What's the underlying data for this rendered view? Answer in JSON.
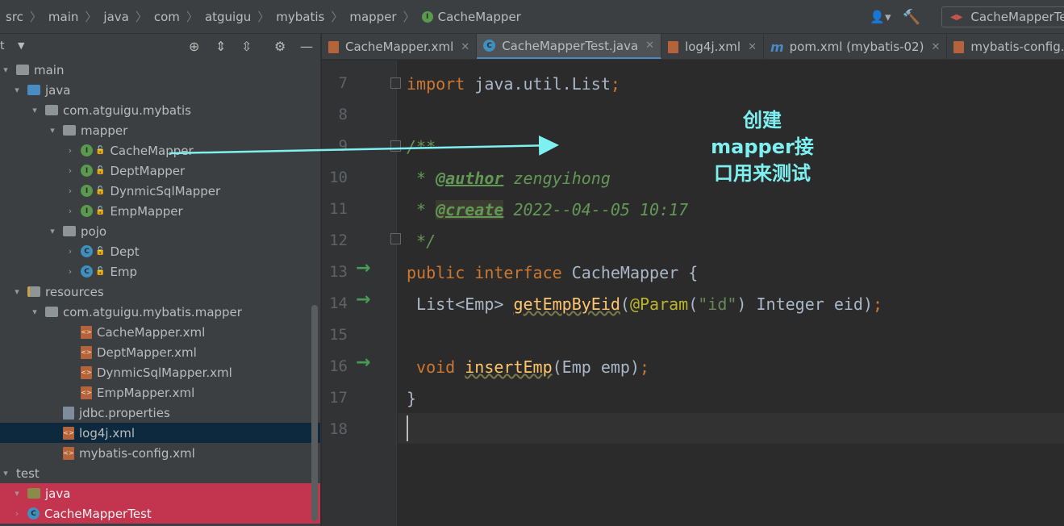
{
  "breadcrumb": [
    "src",
    "main",
    "java",
    "com",
    "atguigu",
    "mybatis",
    "mapper",
    "CacheMapper"
  ],
  "run_config": "CacheMapperTest",
  "project": {
    "title": "t",
    "rows": [
      {
        "label": "main",
        "kind": "folder-grey",
        "indent": 0,
        "arrow": "▾"
      },
      {
        "label": "java",
        "kind": "folder-blue",
        "indent": 1,
        "arrow": "▾"
      },
      {
        "label": "com.atguigu.mybatis",
        "kind": "folder-grey",
        "indent": 2,
        "arrow": "▾"
      },
      {
        "label": "mapper",
        "kind": "folder-grey",
        "indent": 3,
        "arrow": "▾"
      },
      {
        "label": "CacheMapper",
        "kind": "iface",
        "indent": 4,
        "arrow": "›"
      },
      {
        "label": "DeptMapper",
        "kind": "iface",
        "indent": 4,
        "arrow": "›"
      },
      {
        "label": "DynmicSqlMapper",
        "kind": "iface",
        "indent": 4,
        "arrow": "›"
      },
      {
        "label": "EmpMapper",
        "kind": "iface",
        "indent": 4,
        "arrow": "›"
      },
      {
        "label": "pojo",
        "kind": "folder-grey",
        "indent": 3,
        "arrow": "▾"
      },
      {
        "label": "Dept",
        "kind": "class",
        "indent": 4,
        "arrow": "›"
      },
      {
        "label": "Emp",
        "kind": "class",
        "indent": 4,
        "arrow": "›"
      },
      {
        "label": "resources",
        "kind": "folder-res",
        "indent": 1,
        "arrow": "▾"
      },
      {
        "label": "com.atguigu.mybatis.mapper",
        "kind": "folder-grey",
        "indent": 2,
        "arrow": "▾"
      },
      {
        "label": "CacheMapper.xml",
        "kind": "xml",
        "indent": 4,
        "arrow": ""
      },
      {
        "label": "DeptMapper.xml",
        "kind": "xml",
        "indent": 4,
        "arrow": ""
      },
      {
        "label": "DynmicSqlMapper.xml",
        "kind": "xml",
        "indent": 4,
        "arrow": ""
      },
      {
        "label": "EmpMapper.xml",
        "kind": "xml",
        "indent": 4,
        "arrow": ""
      },
      {
        "label": "jdbc.properties",
        "kind": "props",
        "indent": 3,
        "arrow": ""
      },
      {
        "label": "log4j.xml",
        "kind": "xml",
        "indent": 3,
        "arrow": "",
        "selected": true
      },
      {
        "label": "mybatis-config.xml",
        "kind": "xml",
        "indent": 3,
        "arrow": ""
      },
      {
        "label": "test",
        "kind": "none",
        "indent": 0,
        "arrow": "▾"
      },
      {
        "label": "java",
        "kind": "folder-olive",
        "indent": 1,
        "arrow": "▾",
        "highlight": true
      },
      {
        "label": "CacheMapperTest",
        "kind": "testclass",
        "indent": 1,
        "arrow": "›",
        "highlight": true
      }
    ]
  },
  "tabs": [
    {
      "label": "CacheMapper.xml",
      "icon": "xml",
      "active": false
    },
    {
      "label": "CacheMapperTest.java",
      "icon": "java",
      "active": true
    },
    {
      "label": "log4j.xml",
      "icon": "xml",
      "active": false
    },
    {
      "label": "pom.xml (mybatis-02)",
      "icon": "maven",
      "active": false
    },
    {
      "label": "mybatis-config.xml",
      "icon": "xml",
      "active": false
    }
  ],
  "editor": {
    "line_numbers": [
      "7",
      "8",
      "9",
      "10",
      "11",
      "12",
      "13",
      "14",
      "15",
      "16",
      "17",
      "18"
    ],
    "lines": {
      "l7": {
        "kw": "import",
        "rest": " java.util.List",
        "semi": ";"
      },
      "l9": "/**",
      "l10": {
        "star": " * ",
        "tag": "@author",
        "text": " zengyihong"
      },
      "l11": {
        "star": " * ",
        "tag": "@create",
        "text": " 2022--04--05 10:17"
      },
      "l12": " */",
      "l13": {
        "kw1": "public",
        "kw2": " interface",
        "name": " CacheMapper {"
      },
      "l14": {
        "type": " List<Emp> ",
        "fn": "getEmpByEid",
        "open": "(",
        "ann": "@Param",
        "p1": "(",
        "str": "\"id\"",
        "p2": ") Integer eid)",
        "semi": ";"
      },
      "l16": {
        "kw": " void",
        "sp": " ",
        "fn": "insertEmp",
        "args": "(Emp emp)",
        "semi": ";"
      },
      "l17": "}"
    }
  },
  "annotation": {
    "lines": [
      "创建",
      "mapper接",
      "口用来测试"
    ],
    "color": "#7ef0f0"
  }
}
